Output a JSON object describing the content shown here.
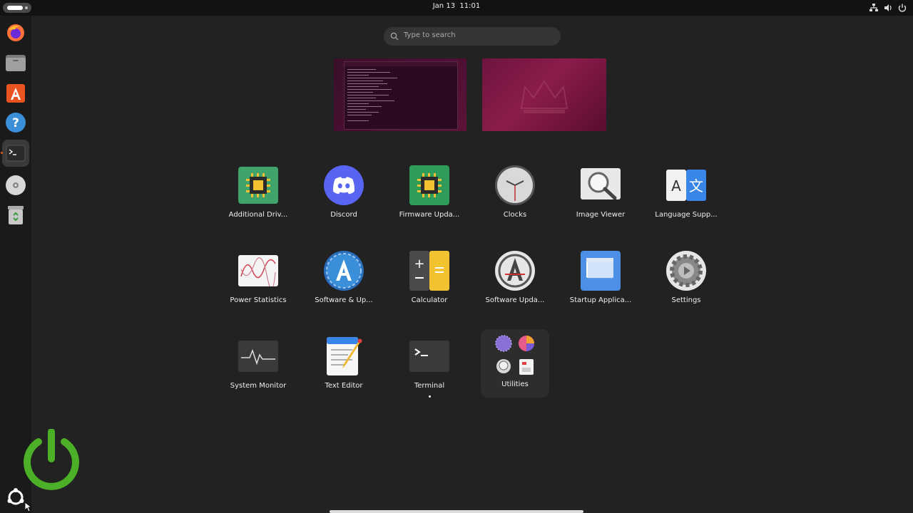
{
  "topbar": {
    "date": "Jan 13",
    "time": "11:01",
    "tray_icons": [
      "network-icon",
      "volume-icon",
      "power-icon"
    ]
  },
  "dock": {
    "items": [
      {
        "name": "Firefox",
        "icon": "firefox-icon"
      },
      {
        "name": "Files",
        "icon": "files-icon"
      },
      {
        "name": "App Center",
        "icon": "app-center-icon"
      },
      {
        "name": "Help",
        "icon": "help-icon"
      },
      {
        "name": "Terminal",
        "icon": "terminal-icon",
        "active": true
      },
      {
        "name": "Disc",
        "icon": "disc-icon"
      },
      {
        "name": "Trash",
        "icon": "trash-icon"
      }
    ],
    "show_apps": "show-apps-icon"
  },
  "search": {
    "placeholder": "Type to search"
  },
  "apps": [
    {
      "label": "Additional Driv...",
      "icon": "chip-icon"
    },
    {
      "label": "Discord",
      "icon": "discord-icon"
    },
    {
      "label": "Firmware Upda...",
      "icon": "firmware-chip-icon"
    },
    {
      "label": "Clocks",
      "icon": "clock-icon"
    },
    {
      "label": "Image Viewer",
      "icon": "magnifier-icon"
    },
    {
      "label": "Language Supp...",
      "icon": "language-icon"
    },
    {
      "label": "Power Statistics",
      "icon": "power-graph-icon"
    },
    {
      "label": "Software & Up...",
      "icon": "software-sources-icon"
    },
    {
      "label": "Calculator",
      "icon": "calculator-icon"
    },
    {
      "label": "Software Upda...",
      "icon": "software-updater-icon"
    },
    {
      "label": "Startup Applica...",
      "icon": "startup-window-icon"
    },
    {
      "label": "Settings",
      "icon": "settings-gear-icon"
    },
    {
      "label": "System Monitor",
      "icon": "system-monitor-icon"
    },
    {
      "label": "Text Editor",
      "icon": "text-editor-icon"
    },
    {
      "label": "Terminal",
      "icon": "terminal-app-icon",
      "running": true
    },
    {
      "label": "Utilities",
      "icon": "folder-utilities-icon",
      "folder": true
    }
  ],
  "colors": {
    "ubuntu_orange": "#e95420",
    "power_green": "#4caf28"
  }
}
